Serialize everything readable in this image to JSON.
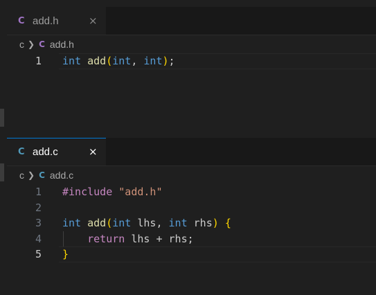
{
  "colors": {
    "background": "#1f1f1f",
    "tabbar": "#181818",
    "keyword": "#569cd6",
    "function": "#dcdcaa",
    "string": "#ce9178",
    "preprocessor": "#c586c0",
    "bracket": "#ffd700",
    "header_icon": "#a074c4",
    "source_icon": "#519aba"
  },
  "top_pane": {
    "tab": {
      "lang_icon": "C",
      "label": "add.h",
      "close": "×"
    },
    "breadcrumb": {
      "folder": "c",
      "lang_icon": "C",
      "file": "add.h"
    },
    "lines": [
      {
        "num": "1",
        "tokens": [
          {
            "t": "int",
            "c": "kw"
          },
          {
            "t": " ",
            "c": "pu"
          },
          {
            "t": "add",
            "c": "fn"
          },
          {
            "t": "(",
            "c": "br1"
          },
          {
            "t": "int",
            "c": "kw"
          },
          {
            "t": ", ",
            "c": "pu"
          },
          {
            "t": "int",
            "c": "kw"
          },
          {
            "t": ")",
            "c": "br1"
          },
          {
            "t": ";",
            "c": "pu"
          }
        ]
      }
    ]
  },
  "bottom_pane": {
    "tab": {
      "lang_icon": "C",
      "label": "add.c",
      "close": "×"
    },
    "breadcrumb": {
      "folder": "c",
      "lang_icon": "C",
      "file": "add.c"
    },
    "lines": [
      {
        "num": "1",
        "tokens": [
          {
            "t": "#include",
            "c": "pp"
          },
          {
            "t": " ",
            "c": "pu"
          },
          {
            "t": "\"add.h\"",
            "c": "st"
          }
        ]
      },
      {
        "num": "2",
        "tokens": []
      },
      {
        "num": "3",
        "tokens": [
          {
            "t": "int",
            "c": "kw"
          },
          {
            "t": " ",
            "c": "pu"
          },
          {
            "t": "add",
            "c": "fn"
          },
          {
            "t": "(",
            "c": "br1"
          },
          {
            "t": "int",
            "c": "kw"
          },
          {
            "t": " lhs, ",
            "c": "pu"
          },
          {
            "t": "int",
            "c": "kw"
          },
          {
            "t": " rhs",
            "c": "pu"
          },
          {
            "t": ")",
            "c": "br1"
          },
          {
            "t": " ",
            "c": "pu"
          },
          {
            "t": "{",
            "c": "br1"
          }
        ]
      },
      {
        "num": "4",
        "tokens": [
          {
            "t": "    ",
            "c": "pu"
          },
          {
            "t": "return",
            "c": "kw2"
          },
          {
            "t": " lhs + rhs;",
            "c": "pu"
          }
        ]
      },
      {
        "num": "5",
        "tokens": [
          {
            "t": "}",
            "c": "br1"
          }
        ]
      }
    ]
  }
}
